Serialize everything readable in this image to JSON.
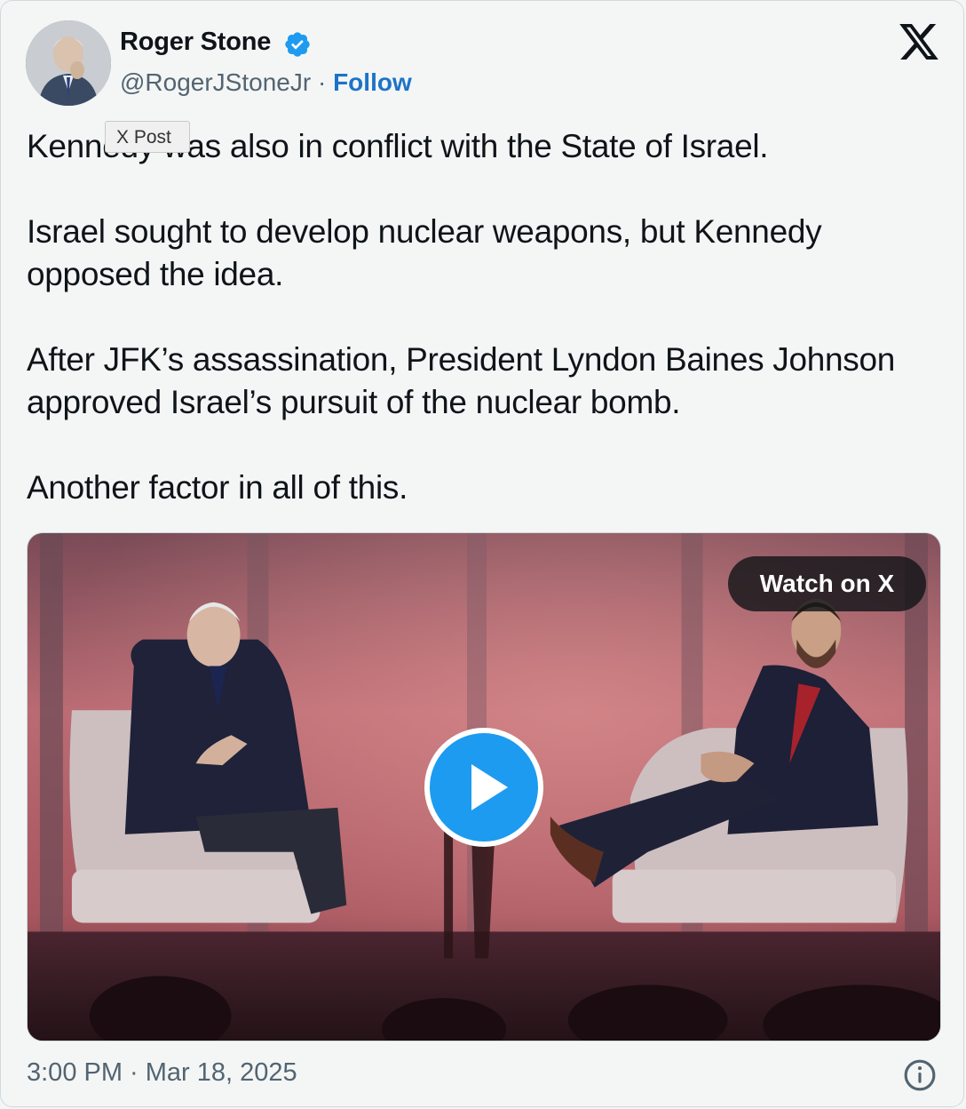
{
  "author": {
    "name": "Roger Stone",
    "handle": "@RogerJStoneJr",
    "separator": "·",
    "follow_label": "Follow"
  },
  "tooltip": "X Post",
  "tweet": {
    "paragraphs": [
      "Kennedy was also in conflict with the State of Israel.",
      "Israel sought to develop nuclear weapons, but Kennedy opposed the idea.",
      "After JFK’s assassination, President Lyndon Baines Johnson approved Israel’s pursuit of the nuclear bomb.",
      "Another factor in all of this."
    ]
  },
  "media": {
    "watch_label": "Watch on X"
  },
  "footer": {
    "timestamp": "3:00 PM · Mar 18, 2025"
  },
  "icons": {
    "verified": "verified-badge-icon",
    "logo": "x-logo-icon",
    "play": "play-icon",
    "info": "info-icon"
  },
  "colors": {
    "accent": "#1d9bf0",
    "follow": "#1d73c9",
    "muted": "#536471",
    "text": "#0f1419"
  }
}
